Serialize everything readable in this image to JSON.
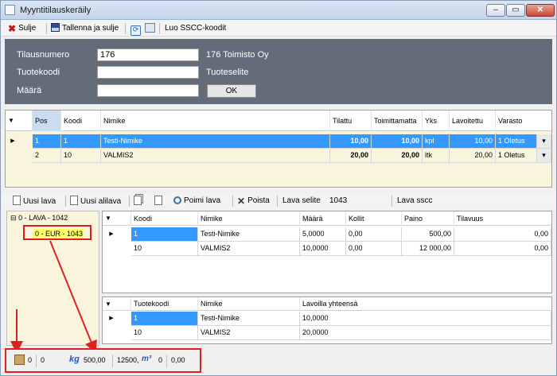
{
  "window": {
    "title": "Myyntitilauskeräily",
    "min": "–",
    "max": "▭",
    "close": "✕"
  },
  "toolbar": {
    "close_label": "Sulje",
    "save_close_label": "Tallenna ja sulje",
    "sscc_label": "Luo SSCC-koodit"
  },
  "header": {
    "order_label": "Tilausnumero",
    "order_value": "176",
    "customer": "176 Toimisto Oy",
    "product_code_label": "Tuotekoodi",
    "product_desc_label": "Tuoteselite",
    "quantity_label": "Määrä",
    "ok_label": "OK"
  },
  "order_grid": {
    "headers": [
      "Pos",
      "Koodi",
      "Nimike",
      "Tilattu",
      "Toimittamatta",
      "Yks",
      "Lavoitettu",
      "Varasto"
    ],
    "rows": [
      [
        "1",
        "1",
        "Testi-Nimike",
        "10,00",
        "10,00",
        "kpl",
        "10,00",
        "1 Oletus"
      ],
      [
        "2",
        "10",
        "VALMIS2",
        "20,00",
        "20,00",
        "ltk",
        "20,00",
        "1 Oletus"
      ]
    ],
    "dropdown_glyph": "▾"
  },
  "pallet_toolbar": {
    "new_pallet": "Uusi lava",
    "new_subpallet": "Uusi alilava",
    "pick_pallet": "Poimi lava",
    "delete": "Poista",
    "pallet_desc_label": "Lava selite",
    "pallet_desc_value": "1043",
    "pallet_sscc_label": "Lava sscc"
  },
  "tree": {
    "root": "0 - LAVA - 1042",
    "child": "0 - EUR - 1043",
    "expander": "⊟"
  },
  "pallet_rows_grid": {
    "headers": [
      "Koodi",
      "Nimike",
      "Määrä",
      "Kollit",
      "Paino",
      "Tilavuus"
    ],
    "rows": [
      [
        "1",
        "Testi-Nimike",
        "5,0000",
        "0,00",
        "500,00",
        "0,00"
      ],
      [
        "10",
        "VALMIS2",
        "10,0000",
        "0,00",
        "12 000,00",
        "0,00"
      ]
    ]
  },
  "summary_grid": {
    "headers": [
      "Tuotekoodi",
      "Nimike",
      "Lavoilla yhteensä"
    ],
    "rows": [
      [
        "1",
        "Testi-Nimike",
        "10,0000"
      ],
      [
        "10",
        "VALMIS2",
        "20,0000"
      ]
    ]
  },
  "statusbar": {
    "count_a": "0",
    "count_b": "0",
    "weight_unit": "kg",
    "weight": "500,00",
    "volume_a": "12500,",
    "volume_unit": "m³",
    "volume_b": "0",
    "volume_c": "0,00"
  },
  "colors": {
    "selection": "#3399ff",
    "highlight": "#e02020",
    "tree_background": "#f8f5dc"
  },
  "sort_glyph": "▼",
  "row_pointer": "▶"
}
